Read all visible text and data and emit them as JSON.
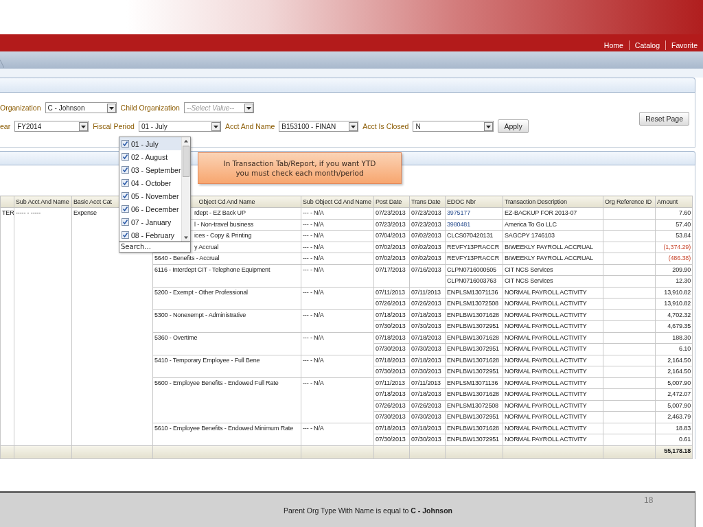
{
  "nav": {
    "links": [
      "Home",
      "Catalog",
      "Favorite"
    ]
  },
  "prompts": {
    "rows": [
      [
        {
          "label": "Organization",
          "value": "C - Johnson"
        },
        {
          "label": "Child Organization",
          "placeholder": "--Select Value--"
        }
      ],
      [
        {
          "label": "ear",
          "value": "FY2014"
        },
        {
          "label": "Fiscal Period",
          "value": "01 - July"
        },
        {
          "label": "Acct And Name",
          "value": "B153100 - FINAN"
        },
        {
          "label": "Acct Is Closed",
          "value": "N"
        }
      ]
    ],
    "apply_button": "Apply",
    "reset_button": "Reset Page"
  },
  "dropdown": {
    "items": [
      {
        "label": "01 - July",
        "checked": true,
        "selected": true
      },
      {
        "label": "02 - August",
        "checked": true,
        "selected": false
      },
      {
        "label": "03 - September",
        "checked": true,
        "selected": false
      },
      {
        "label": "04 - October",
        "checked": true,
        "selected": false
      },
      {
        "label": "05 - November",
        "checked": true,
        "selected": false
      },
      {
        "label": "06 - December",
        "checked": true,
        "selected": false
      },
      {
        "label": "07 - January",
        "checked": true,
        "selected": false
      },
      {
        "label": "08 - February",
        "checked": true,
        "selected": false
      }
    ],
    "search": "Search..."
  },
  "callout": {
    "text": "In Transaction Tab/Report, if you want YTD you must check each month/period"
  },
  "table": {
    "columns": [
      "",
      "Sub Acct And Name",
      "Basic Acct Cat",
      "Object Cd And Name",
      "Sub Object Cd And Name",
      "Post Date",
      "Trans Date",
      "EDOC Nbr",
      "Transaction Description",
      "Org Reference ID",
      "Amount"
    ],
    "account": {
      "column_1": "TER",
      "sub_acct": "----- - -----",
      "basic_cat": "Expense"
    },
    "groups": [
      {
        "object": "rdept - EZ Back UP",
        "sub_object": "--- - N/A",
        "lines": [
          {
            "post_date": "07/23/2013",
            "trans_date": "07/23/2013",
            "edoc": "3975177",
            "edoc_link": true,
            "description": "EZ-BACKUP FOR 2013-07",
            "amount": "7.60",
            "negative": false
          }
        ]
      },
      {
        "object": "l - Non-travel business",
        "sub_object": "--- - N/A",
        "lines": [
          {
            "post_date": "07/23/2013",
            "trans_date": "07/23/2013",
            "edoc": "3980481",
            "edoc_link": true,
            "description": "America To Go LLC",
            "amount": "57.40",
            "negative": false
          }
        ]
      },
      {
        "object": "ices - Copy & Printing",
        "sub_object": "--- - N/A",
        "lines": [
          {
            "post_date": "07/04/2013",
            "trans_date": "07/02/2013",
            "edoc": "CLCS070420131",
            "edoc_link": false,
            "description": "SAGCPY 1746103",
            "amount": "53.84",
            "negative": false
          }
        ]
      },
      {
        "object": "y Accrual",
        "sub_object": "--- - N/A",
        "lines": [
          {
            "post_date": "07/02/2013",
            "trans_date": "07/02/2013",
            "edoc": "REVFY13PRACCR",
            "edoc_link": false,
            "description": "BIWEEKLY PAYROLL ACCRUAL",
            "amount": "(1,374.29)",
            "negative": true
          }
        ]
      },
      {
        "object": "5640 - Benefits - Accrual",
        "sub_object": "--- - N/A",
        "lines": [
          {
            "post_date": "07/02/2013",
            "trans_date": "07/02/2013",
            "edoc": "REVFY13PRACCR",
            "edoc_link": false,
            "description": "BIWEEKLY PAYROLL ACCRUAL",
            "amount": "(486.38)",
            "negative": true
          }
        ]
      },
      {
        "object": "6116 - Interdept CIT - Telephone Equipment",
        "sub_object": "--- - N/A",
        "lines": [
          {
            "post_date": "07/17/2013",
            "trans_date": "07/16/2013",
            "edoc": "CLPN0716000505",
            "edoc_link": false,
            "description": "CIT NCS Services",
            "amount": "209.90",
            "negative": false
          },
          {
            "edoc": "CLPN0716003763",
            "edoc_link": false,
            "description": "CIT NCS Services",
            "amount": "12.30",
            "negative": false
          }
        ]
      },
      {
        "object": "5200 - Exempt - Other Professional",
        "sub_object": "--- - N/A",
        "lines": [
          {
            "post_date": "07/11/2013",
            "trans_date": "07/11/2013",
            "edoc": "ENPLSM13071136",
            "edoc_link": false,
            "description": "NORMAL PAYROLL ACTIVITY",
            "amount": "13,910.82",
            "negative": false
          },
          {
            "post_date": "07/26/2013",
            "trans_date": "07/26/2013",
            "edoc": "ENPLSM13072508",
            "edoc_link": false,
            "description": "NORMAL PAYROLL ACTIVITY",
            "amount": "13,910.82",
            "negative": false
          }
        ]
      },
      {
        "object": "5300 - Nonexempt - Administrative",
        "sub_object": "--- - N/A",
        "lines": [
          {
            "post_date": "07/18/2013",
            "trans_date": "07/18/2013",
            "edoc": "ENPLBW13071628",
            "edoc_link": false,
            "description": "NORMAL PAYROLL ACTIVITY",
            "amount": "4,702.32",
            "negative": false
          },
          {
            "post_date": "07/30/2013",
            "trans_date": "07/30/2013",
            "edoc": "ENPLBW13072951",
            "edoc_link": false,
            "description": "NORMAL PAYROLL ACTIVITY",
            "amount": "4,679.35",
            "negative": false
          }
        ]
      },
      {
        "object": "5360 - Overtime",
        "sub_object": "--- - N/A",
        "lines": [
          {
            "post_date": "07/18/2013",
            "trans_date": "07/18/2013",
            "edoc": "ENPLBW13071628",
            "edoc_link": false,
            "description": "NORMAL PAYROLL ACTIVITY",
            "amount": "188.30",
            "negative": false
          },
          {
            "post_date": "07/30/2013",
            "trans_date": "07/30/2013",
            "edoc": "ENPLBW13072951",
            "edoc_link": false,
            "description": "NORMAL PAYROLL ACTIVITY",
            "amount": "6.10",
            "negative": false
          }
        ]
      },
      {
        "object": "5410 - Temporary Employee - Full Bene",
        "sub_object": "--- - N/A",
        "lines": [
          {
            "post_date": "07/18/2013",
            "trans_date": "07/18/2013",
            "edoc": "ENPLBW13071628",
            "edoc_link": false,
            "description": "NORMAL PAYROLL ACTIVITY",
            "amount": "2,164.50",
            "negative": false
          },
          {
            "post_date": "07/30/2013",
            "trans_date": "07/30/2013",
            "edoc": "ENPLBW13072951",
            "edoc_link": false,
            "description": "NORMAL PAYROLL ACTIVITY",
            "amount": "2,164.50",
            "negative": false
          }
        ]
      },
      {
        "object": "5600 - Employee Benefits - Endowed Full Rate",
        "sub_object": "--- - N/A",
        "lines": [
          {
            "post_date": "07/11/2013",
            "trans_date": "07/11/2013",
            "edoc": "ENPLSM13071136",
            "edoc_link": false,
            "description": "NORMAL PAYROLL ACTIVITY",
            "amount": "5,007.90",
            "negative": false
          },
          {
            "post_date": "07/18/2013",
            "trans_date": "07/18/2013",
            "edoc": "ENPLBW13071628",
            "edoc_link": false,
            "description": "NORMAL PAYROLL ACTIVITY",
            "amount": "2,472.07",
            "negative": false
          },
          {
            "post_date": "07/26/2013",
            "trans_date": "07/26/2013",
            "edoc": "ENPLSM13072508",
            "edoc_link": false,
            "description": "NORMAL PAYROLL ACTIVITY",
            "amount": "5,007.90",
            "negative": false
          },
          {
            "post_date": "07/30/2013",
            "trans_date": "07/30/2013",
            "edoc": "ENPLBW13072951",
            "edoc_link": false,
            "description": "NORMAL PAYROLL ACTIVITY",
            "amount": "2,463.79",
            "negative": false
          }
        ]
      },
      {
        "object": "5610 - Employee Benefits - Endowed Minimum Rate",
        "sub_object": "--- - N/A",
        "lines": [
          {
            "post_date": "07/18/2013",
            "trans_date": "07/18/2013",
            "edoc": "ENPLBW13071628",
            "edoc_link": false,
            "description": "NORMAL PAYROLL ACTIVITY",
            "amount": "18.83",
            "negative": false
          },
          {
            "post_date": "07/30/2013",
            "trans_date": "07/30/2013",
            "edoc": "ENPLBW13072951",
            "edoc_link": false,
            "description": "NORMAL PAYROLL ACTIVITY",
            "amount": "0.61",
            "negative": false
          }
        ]
      }
    ],
    "total": "55,178.18"
  },
  "filter_summary": {
    "text": "Parent Org Type With Name is equal to **C - Johnson**"
  },
  "slide_number": "18"
}
